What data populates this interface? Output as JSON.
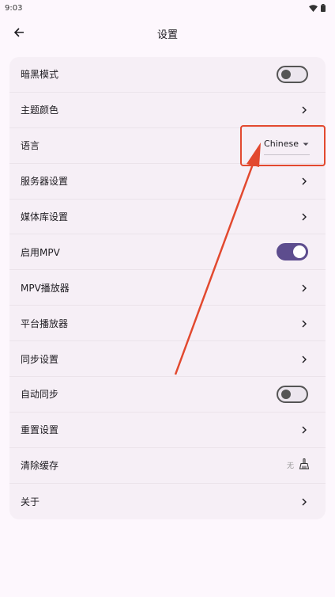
{
  "status_bar": {
    "time": "9:03"
  },
  "app_bar": {
    "title": "设置"
  },
  "settings": {
    "dark_mode_label": "暗黑模式",
    "theme_color_label": "主题颜色",
    "language_label": "语言",
    "language_value": "Chinese",
    "server_settings_label": "服务器设置",
    "media_library_settings_label": "媒体库设置",
    "enable_mpv_label": "启用MPV",
    "mpv_player_label": "MPV播放器",
    "platform_player_label": "平台播放器",
    "sync_settings_label": "同步设置",
    "auto_sync_label": "自动同步",
    "reset_settings_label": "重置设置",
    "clear_cache_label": "清除缓存",
    "cache_size": "无",
    "about_label": "关于"
  },
  "toggles": {
    "dark_mode": false,
    "enable_mpv": true,
    "auto_sync": false
  },
  "colors": {
    "accent": "#5d4d8e",
    "annotation": "#e2492f",
    "background": "#fdf7fd",
    "card": "#f6eff6"
  }
}
